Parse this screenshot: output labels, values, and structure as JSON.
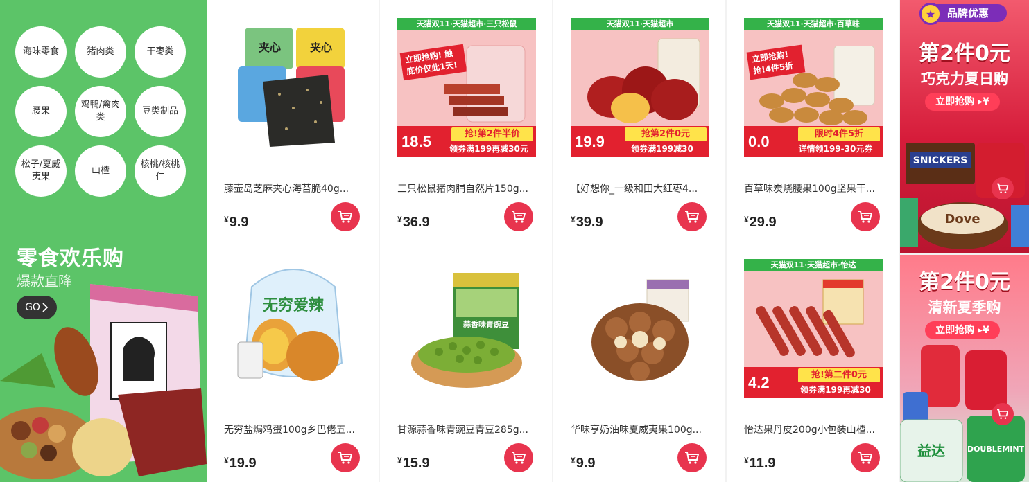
{
  "categories": [
    "海味零食",
    "猪肉类",
    "干枣类",
    "腰果",
    "鸡鸭/禽肉类",
    "豆类制品",
    "松子/夏威夷果",
    "山楂",
    "核桃/核桃仁"
  ],
  "promo": {
    "title": "零食欢乐购",
    "subtitle": "爆款直降",
    "go_label": "GO"
  },
  "products": [
    {
      "name": "藤壶岛芝麻夹心海苔脆40g...",
      "currency": "¥",
      "price": "9.9"
    },
    {
      "name": "三只松鼠猪肉脯自然片150g...",
      "currency": "¥",
      "price": "36.9",
      "banner": {
        "top": "天猫双11·天猫超市·三只松鼠",
        "stamp": "立即抢购! 触底价仅此1天!",
        "price": "18.5",
        "tag": "抢!第2件半价",
        "note": "领券满199再减30元"
      }
    },
    {
      "name": "【好想你_一级和田大红枣4...",
      "currency": "¥",
      "price": "39.9",
      "banner": {
        "top": "天猫双11·天猫超市",
        "stamp": "",
        "price": "19.9",
        "tag": "抢第2件0元",
        "note": "领券满199减30"
      }
    },
    {
      "name": "百草味炭烧腰果100g坚果干...",
      "currency": "¥",
      "price": "29.9",
      "banner": {
        "top": "天猫双11·天猫超市·百草味",
        "stamp": "立即抢购! 抢!4件5折",
        "price": "0.0",
        "tag": "限时4件5折",
        "note": "详情领199-30元券"
      }
    },
    {
      "name": "无穷盐焗鸡蛋100g乡巴佬五...",
      "currency": "¥",
      "price": "19.9"
    },
    {
      "name": "甘源蒜香味青豌豆青豆285g...",
      "currency": "¥",
      "price": "15.9"
    },
    {
      "name": "华味亨奶油味夏威夷果100g...",
      "currency": "¥",
      "price": "9.9"
    },
    {
      "name": "怡达果丹皮200g小包装山楂...",
      "currency": "¥",
      "price": "11.9",
      "banner": {
        "top": "天猫双11·天猫超市·怡达",
        "stamp": "",
        "price": "4.2",
        "tag": "抢!第二件0元",
        "note": "领券满199再减30"
      }
    }
  ],
  "ads": [
    {
      "brand_tag": "品牌优惠",
      "title": "第2件0元",
      "subtitle": "巧克力夏日购",
      "button": "立即抢购 ▸¥"
    },
    {
      "title": "第2件0元",
      "subtitle": "清新夏季购",
      "button": "立即抢购 ▸¥"
    }
  ],
  "colors": {
    "panel_green": "#5cc468",
    "cart_red": "#e8344e",
    "banner_red": "#e2212f",
    "banner_green": "#34b249"
  }
}
